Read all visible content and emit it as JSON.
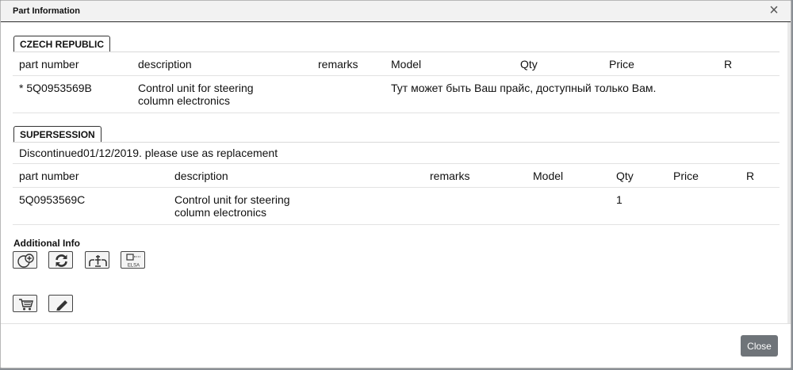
{
  "dialog": {
    "title": "Part Information",
    "close_glyph": "×",
    "close_button_label": "Close"
  },
  "primary": {
    "section_label": "CZECH REPUBLIC",
    "columns": [
      "part number",
      "description",
      "remarks",
      "Model",
      "Qty",
      "Price",
      "R"
    ],
    "rows": [
      {
        "part_number": "* 5Q0953569B",
        "description_line1": "Control unit for steering",
        "description_line2": "column electronics",
        "remarks": "",
        "model": "Тут может быть Ваш прайс, доступный только Вам.",
        "qty": "",
        "price": "",
        "r": ""
      }
    ]
  },
  "supersession": {
    "section_label": "SUPERSESSION",
    "note": "Discontinued01/12/2019. please use as replacement",
    "columns": [
      "part number",
      "description",
      "remarks",
      "Model",
      "Qty",
      "Price",
      "R"
    ],
    "rows": [
      {
        "part_number": "5Q0953569C",
        "description_line1": "Control unit for steering",
        "description_line2": "column electronics",
        "remarks": "",
        "model": "",
        "qty": "1",
        "price": "",
        "r": ""
      }
    ]
  },
  "additional_info": {
    "title": "Additional Info",
    "icons": [
      "add-circle-icon",
      "refresh-icon",
      "tools-icon",
      "elsa-icon"
    ],
    "elsa_text": "ELSA"
  },
  "actions": {
    "icons": [
      "cart-icon",
      "pencil-icon"
    ]
  },
  "colors": {
    "close_button_bg": "#6f7479",
    "title_bar_bg": "#f2f2f2",
    "backdrop": "#8a8f95"
  }
}
